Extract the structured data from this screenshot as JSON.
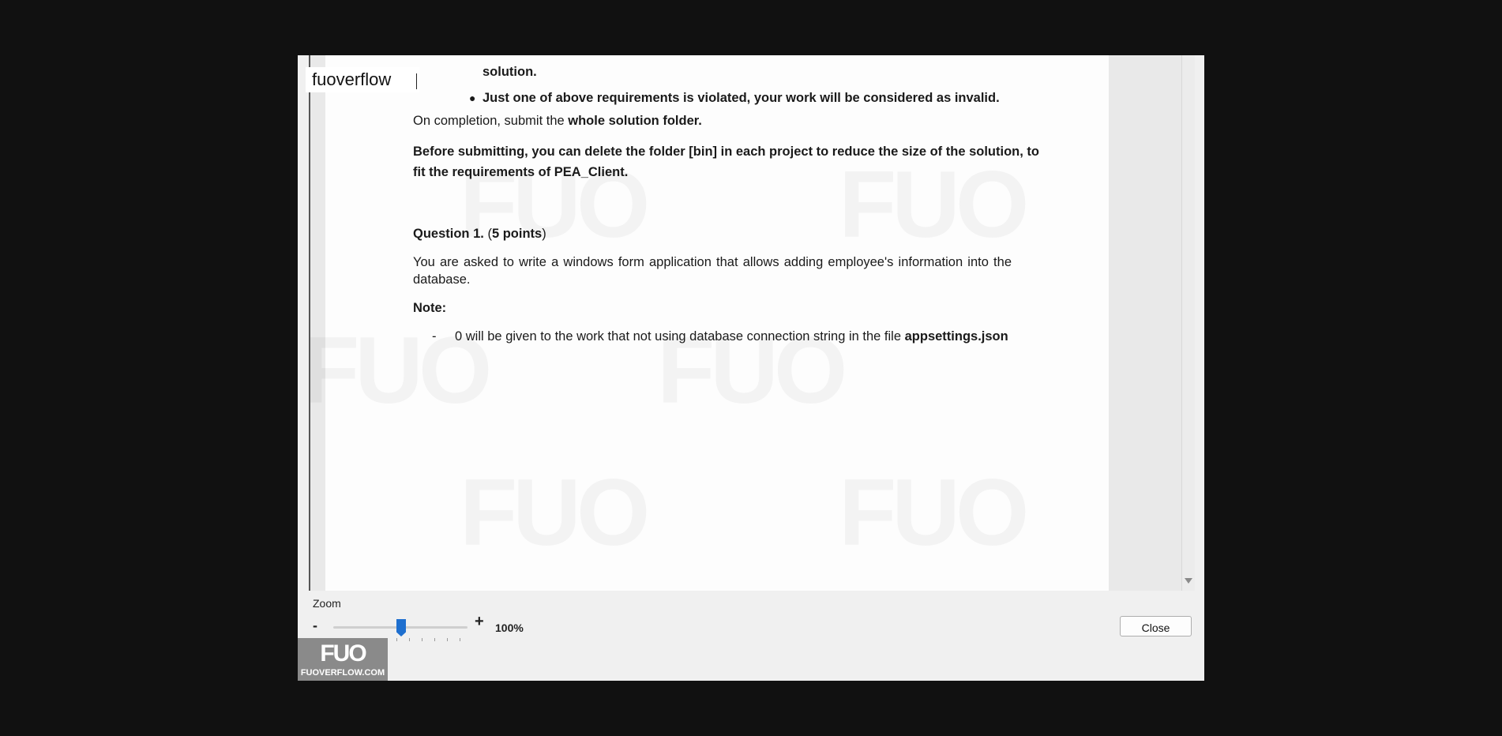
{
  "watermark_input": {
    "value": "fuoverflow"
  },
  "document": {
    "bullet_cont": "solution.",
    "bullet_2": "Just one of above requirements is violated, your work will be considered as invalid.",
    "completion_prefix": "On completion, submit the ",
    "completion_bold": "whole solution folder.",
    "before_submitting_line1": "Before submitting, you can delete the folder [bin] in each project to reduce the size of the solution, to",
    "before_submitting_line2": "fit the requirements of PEA_Client.",
    "question_title": "Question 1.",
    "question_points_open": " (",
    "question_points": "5 points",
    "question_points_close": ")",
    "question_text_line1": "You are asked to write a windows form application that allows adding employee's information into the",
    "question_text_line2": "database.",
    "note_label": "Note:",
    "note_dash": "-",
    "note_text": "0 will be given to the work that not using database connection string in the file ",
    "note_bold": "appsettings.json"
  },
  "zoom": {
    "label": "Zoom",
    "minus": "-",
    "plus": "+",
    "value": "100%",
    "level_fraction": 0.47
  },
  "close_button": {
    "label": "Close"
  },
  "logo": {
    "mark": "FUO",
    "text": "FUOVERFLOW.COM"
  }
}
